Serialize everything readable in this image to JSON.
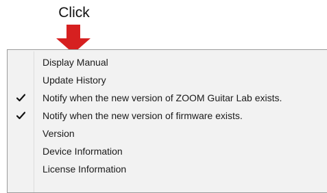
{
  "callout": {
    "label": "Click",
    "arrow_color": "#d62020"
  },
  "menu": {
    "items": [
      {
        "label": "Display Manual",
        "checked": false
      },
      {
        "label": "Update History",
        "checked": false
      },
      {
        "label": "Notify when the new version of ZOOM Guitar Lab exists.",
        "checked": true
      },
      {
        "label": "Notify when the new version of firmware exists.",
        "checked": true
      },
      {
        "label": "Version",
        "checked": false
      },
      {
        "label": "Device Information",
        "checked": false
      },
      {
        "label": "License Information",
        "checked": false
      }
    ]
  }
}
